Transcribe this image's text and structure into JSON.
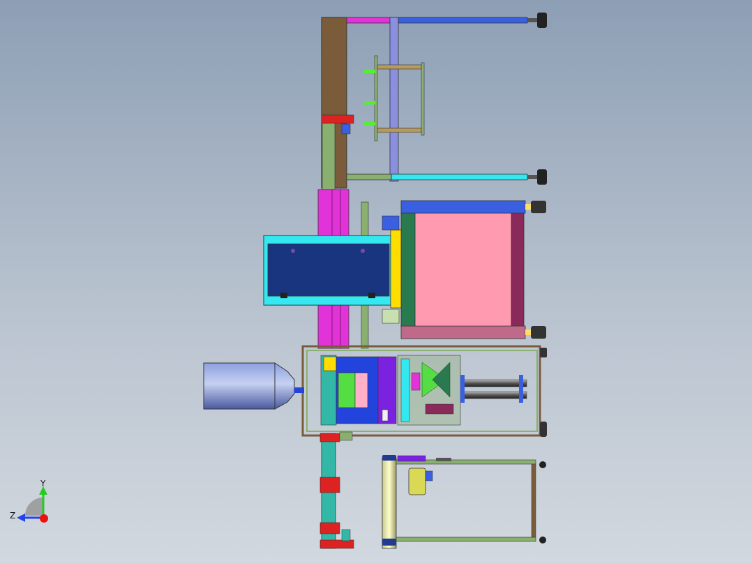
{
  "view": {
    "type": "cad-assembly-drawing",
    "background": {
      "top": "#8d9fb5",
      "bottom": "#d2d8df"
    }
  },
  "triad": {
    "y_label": "Y",
    "z_label": "Z",
    "y_color": "#22cc22",
    "z_color": "#2244ee",
    "origin_color": "#ee1111"
  },
  "colors": {
    "magenta": "#e233d9",
    "blue": "#3a5fe0",
    "cyan": "#33e8f0",
    "lavender": "#8a8fe0",
    "brown": "#7a5c3a",
    "olive_green": "#8ab070",
    "navy": "#1a3580",
    "pink": "#ff9ab0",
    "dark_green": "#2a7a50",
    "maroon": "#8a2a5a",
    "yellow": "#ffdd00",
    "purple": "#7a22e0",
    "teal": "#33b8a8",
    "red": "#dd2222",
    "cylinder_blue": "#6a80c8",
    "grey_frame": "#7a7a7a"
  }
}
